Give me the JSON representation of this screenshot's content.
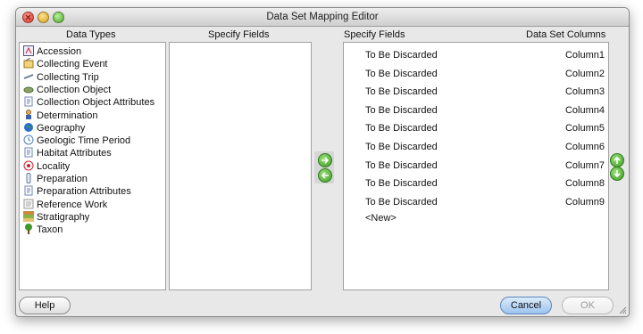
{
  "window": {
    "title": "Data Set Mapping Editor"
  },
  "columns": {
    "data_types": "Data Types",
    "specify_fields_left": "Specify Fields",
    "specify_fields_right": "Specify Fields",
    "data_set_columns": "Data Set Columns"
  },
  "data_types": [
    {
      "label": "Accession",
      "icon": "accession-icon"
    },
    {
      "label": "Collecting Event",
      "icon": "collecting-event-icon"
    },
    {
      "label": "Collecting Trip",
      "icon": "collecting-trip-icon"
    },
    {
      "label": "Collection Object",
      "icon": "collection-object-icon"
    },
    {
      "label": "Collection Object Attributes",
      "icon": "attributes-icon"
    },
    {
      "label": "Determination",
      "icon": "determination-icon"
    },
    {
      "label": "Geography",
      "icon": "geography-icon"
    },
    {
      "label": "Geologic Time Period",
      "icon": "geologic-time-icon"
    },
    {
      "label": "Habitat Attributes",
      "icon": "attributes-icon"
    },
    {
      "label": "Locality",
      "icon": "locality-icon"
    },
    {
      "label": "Preparation",
      "icon": "preparation-icon"
    },
    {
      "label": "Preparation Attributes",
      "icon": "attributes-icon"
    },
    {
      "label": "Reference Work",
      "icon": "reference-work-icon"
    },
    {
      "label": "Stratigraphy",
      "icon": "stratigraphy-icon"
    },
    {
      "label": "Taxon",
      "icon": "taxon-icon"
    }
  ],
  "mappings": [
    {
      "field": "To Be Discarded",
      "column": "Column1"
    },
    {
      "field": "To Be Discarded",
      "column": "Column2"
    },
    {
      "field": "To Be Discarded",
      "column": "Column3"
    },
    {
      "field": "To Be Discarded",
      "column": "Column4"
    },
    {
      "field": "To Be Discarded",
      "column": "Column5"
    },
    {
      "field": "To Be Discarded",
      "column": "Column6"
    },
    {
      "field": "To Be Discarded",
      "column": "Column7"
    },
    {
      "field": "To Be Discarded",
      "column": "Column8"
    },
    {
      "field": "To Be Discarded",
      "column": "Column9"
    }
  ],
  "new_entry": "<New>",
  "buttons": {
    "help": "Help",
    "cancel": "Cancel",
    "ok": "OK"
  },
  "colors": {
    "arrow_green": "#3a9b24",
    "default_button": "#9cc4ef"
  }
}
